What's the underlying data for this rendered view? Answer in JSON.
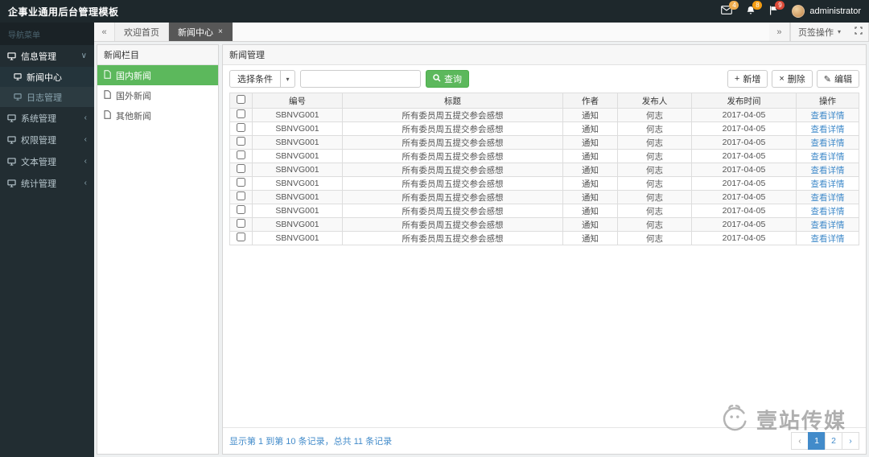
{
  "colors": {
    "accent_green": "#5cb85c",
    "link_blue": "#428bca",
    "messages_badge": "#f0ad4e",
    "notifications_badge": "#f39c12",
    "tasks_badge": "#dd4b39"
  },
  "topbar": {
    "title": "企事业通用后台管理模板",
    "username": "administrator",
    "messages_badge": "4",
    "notifications_badge": "8",
    "tasks_badge": "9"
  },
  "sidebar": {
    "section_label": "导航菜单",
    "items": [
      {
        "label": "信息管理"
      },
      {
        "label": "新闻中心"
      },
      {
        "label": "日志管理"
      },
      {
        "label": "系统管理"
      },
      {
        "label": "权限管理"
      },
      {
        "label": "文本管理"
      },
      {
        "label": "统计管理"
      }
    ],
    "chevron_expanded": "∨",
    "chevron_collapsed": "‹"
  },
  "tabbar": {
    "scroll_left": "«",
    "scroll_right": "»",
    "tabs": [
      {
        "label": "欢迎首页"
      },
      {
        "label": "新闻中心",
        "close": "×"
      }
    ],
    "ops_label": "页签操作",
    "caret": "▾"
  },
  "columns_panel": {
    "title": "新闻栏目",
    "items": [
      {
        "label": "国内新闻"
      },
      {
        "label": "国外新闻"
      },
      {
        "label": "其他新闻"
      }
    ]
  },
  "main": {
    "panel_title": "新闻管理",
    "toolbar": {
      "condition_label": "选择条件",
      "caret": "▾",
      "search_value": "",
      "query_button": "查询",
      "add_button": "新增",
      "delete_button": "删除",
      "edit_button": "编辑",
      "add_glyph": "+",
      "delete_glyph": "×",
      "edit_glyph": "✎"
    },
    "table": {
      "headers": [
        "编号",
        "标题",
        "作者",
        "发布人",
        "发布时间",
        "操作"
      ],
      "action_label": "查看详情",
      "rows": [
        {
          "id": "SBNVG001",
          "title": "所有委员周五提交参会感想",
          "author": "通知",
          "publisher": "何志",
          "date": "2017-04-05"
        },
        {
          "id": "SBNVG001",
          "title": "所有委员周五提交参会感想",
          "author": "通知",
          "publisher": "何志",
          "date": "2017-04-05"
        },
        {
          "id": "SBNVG001",
          "title": "所有委员周五提交参会感想",
          "author": "通知",
          "publisher": "何志",
          "date": "2017-04-05"
        },
        {
          "id": "SBNVG001",
          "title": "所有委员周五提交参会感想",
          "author": "通知",
          "publisher": "何志",
          "date": "2017-04-05"
        },
        {
          "id": "SBNVG001",
          "title": "所有委员周五提交参会感想",
          "author": "通知",
          "publisher": "何志",
          "date": "2017-04-05"
        },
        {
          "id": "SBNVG001",
          "title": "所有委员周五提交参会感想",
          "author": "通知",
          "publisher": "何志",
          "date": "2017-04-05"
        },
        {
          "id": "SBNVG001",
          "title": "所有委员周五提交参会感想",
          "author": "通知",
          "publisher": "何志",
          "date": "2017-04-05"
        },
        {
          "id": "SBNVG001",
          "title": "所有委员周五提交参会感想",
          "author": "通知",
          "publisher": "何志",
          "date": "2017-04-05"
        },
        {
          "id": "SBNVG001",
          "title": "所有委员周五提交参会感想",
          "author": "通知",
          "publisher": "何志",
          "date": "2017-04-05"
        },
        {
          "id": "SBNVG001",
          "title": "所有委员周五提交参会感想",
          "author": "通知",
          "publisher": "何志",
          "date": "2017-04-05"
        }
      ]
    },
    "footer": {
      "summary": "显示第 1 到第 10 条记录，总共 11 条记录",
      "pagination": {
        "prev": "‹",
        "pages": [
          "1",
          "2"
        ],
        "next": "›",
        "active_page": "1"
      }
    }
  },
  "watermark": {
    "text": "壹站传媒"
  }
}
